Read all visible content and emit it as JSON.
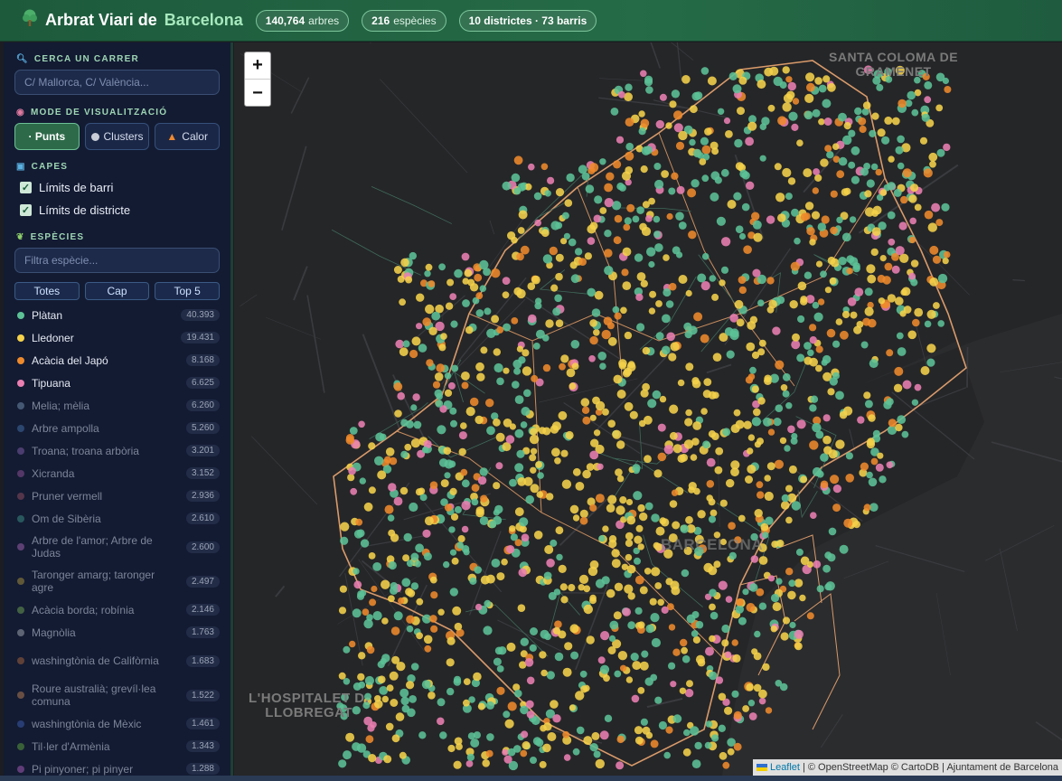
{
  "header": {
    "title_pre": "Arbrat Viari de",
    "title_accent": "Barcelona",
    "stats": [
      {
        "value": "140,764",
        "label": "arbres"
      },
      {
        "value": "216",
        "label": "espècies"
      },
      {
        "value": "10 districtes · 73 barris",
        "label": ""
      }
    ],
    "icon": "tree-icon"
  },
  "search": {
    "section": "CERCA UN CARRER",
    "placeholder": "C/ Mallorca, C/ València..."
  },
  "mode": {
    "section": "MODE DE VISUALITZACIÓ",
    "options": [
      {
        "label": "· Punts",
        "active": true
      },
      {
        "label": "Clusters",
        "active": false
      },
      {
        "label": "Calor",
        "active": false
      }
    ]
  },
  "layers": {
    "section": "CAPES",
    "items": [
      {
        "label": "Límits de barri",
        "checked": true
      },
      {
        "label": "Límits de districte",
        "checked": true
      }
    ]
  },
  "species": {
    "section": "ESPÈCIES",
    "placeholder": "Filtra espècie...",
    "buttons": [
      "Totes",
      "Cap",
      "Top 5"
    ],
    "list": [
      {
        "name": "Plàtan",
        "count": "40.393",
        "color": "#5cc296",
        "active": true
      },
      {
        "name": "Lledoner",
        "count": "19.431",
        "color": "#f5d24a",
        "active": true
      },
      {
        "name": "Acàcia del Japó",
        "count": "8.168",
        "color": "#ee8a2b",
        "active": true
      },
      {
        "name": "Tipuana",
        "count": "6.625",
        "color": "#eb7fb2",
        "active": true
      },
      {
        "name": "Melia; mèlia",
        "count": "6.260",
        "color": "#6f8aa8",
        "active": false
      },
      {
        "name": "Arbre ampolla",
        "count": "5.260",
        "color": "#3f6aa0",
        "active": false
      },
      {
        "name": "Troana; troana arbòria",
        "count": "3.201",
        "color": "#7a5aa0",
        "active": false
      },
      {
        "name": "Xicranda",
        "count": "3.152",
        "color": "#8a4f92",
        "active": false
      },
      {
        "name": "Pruner vermell",
        "count": "2.936",
        "color": "#8a4a5c",
        "active": false
      },
      {
        "name": "Om de Sibèria",
        "count": "2.610",
        "color": "#3b8a80",
        "active": false
      },
      {
        "name": "Arbre de l'amor; Arbre de Judas",
        "count": "2.600",
        "color": "#9a5fa8",
        "active": false
      },
      {
        "name": "Taronger amarg; taronger agre",
        "count": "2.497",
        "color": "#a08a3a",
        "active": false
      },
      {
        "name": "Acàcia borda; robínia",
        "count": "2.146",
        "color": "#6a9a50",
        "active": false
      },
      {
        "name": "Magnòlia",
        "count": "1.763",
        "color": "#9aa0a8",
        "active": false
      },
      {
        "name": "washingtònia de Califòrnia",
        "count": "1.683",
        "color": "#a0603a",
        "active": false
      },
      {
        "name": "Roure australià; grevíl·lea comuna",
        "count": "1.522",
        "color": "#b07a50",
        "active": false
      },
      {
        "name": "washingtònia de Mèxic",
        "count": "1.461",
        "color": "#3a5aa8",
        "active": false
      },
      {
        "name": "Til·ler d'Armènia",
        "count": "1.343",
        "color": "#5a9a3a",
        "active": false
      },
      {
        "name": "Pi pinyoner; pi pinyer",
        "count": "1.288",
        "color": "#a05ab0",
        "active": false
      }
    ]
  },
  "map": {
    "zoom_in": "+",
    "zoom_out": "−",
    "labels": [
      "SANTA COLOMA DE\nGRAMENET",
      "L'HOSPITALET D.\nLLOBREGAT",
      "BARCELONA"
    ],
    "attribution": {
      "leaflet": "Leaflet",
      "rest": "| © OpenStreetMap © CartoDB | Ajuntament de Barcelona"
    }
  }
}
